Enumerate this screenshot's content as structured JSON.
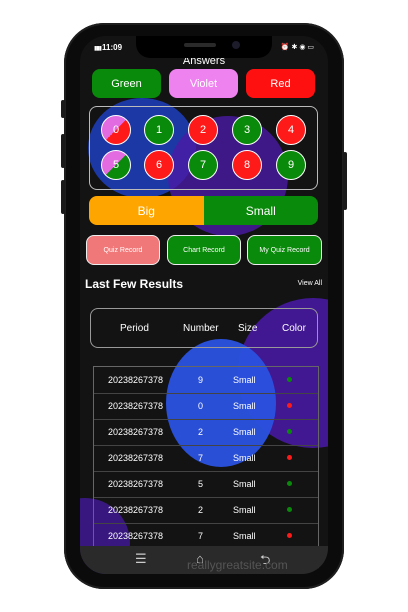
{
  "status_bar": {
    "time": "11:09",
    "signal": "▮▮▮",
    "indicators": "⏰ ✱ ◉ ▭"
  },
  "answers": {
    "title": "Answers",
    "color_buttons": [
      {
        "label": "Green",
        "color": "#0a8a0a"
      },
      {
        "label": "Violet",
        "color": "#ee82ee"
      },
      {
        "label": "Red",
        "color": "#ff1010"
      }
    ],
    "numbers": [
      {
        "label": "0",
        "colors": [
          "#ff1a1a",
          "#e26be2"
        ]
      },
      {
        "label": "1",
        "colors": [
          "#0a8a0a"
        ]
      },
      {
        "label": "2",
        "colors": [
          "#ff1a1a"
        ]
      },
      {
        "label": "3",
        "colors": [
          "#0a8a0a"
        ]
      },
      {
        "label": "4",
        "colors": [
          "#ff1a1a"
        ]
      },
      {
        "label": "5",
        "colors": [
          "#0a8a0a",
          "#e26be2"
        ]
      },
      {
        "label": "6",
        "colors": [
          "#ff1a1a"
        ]
      },
      {
        "label": "7",
        "colors": [
          "#0a8a0a"
        ]
      },
      {
        "label": "8",
        "colors": [
          "#ff1a1a"
        ]
      },
      {
        "label": "9",
        "colors": [
          "#0a8a0a"
        ]
      }
    ],
    "big_label": "Big",
    "small_label": "Small",
    "big_color": "#ffa500",
    "small_color": "#0a8a0a"
  },
  "actions": {
    "quiz_record": "Quiz Record",
    "chart_record": "Chart Record",
    "my_quiz_record": "My Quiz Record",
    "quiz_record_color": "#f07878",
    "green": "#0a8a0a"
  },
  "results": {
    "title": "Last Few Results",
    "view_all": "View All",
    "columns": {
      "period": "Period",
      "number": "Number",
      "size": "Size",
      "color": "Color"
    },
    "rows": [
      {
        "period": "20238267378",
        "number": "9",
        "size": "Small",
        "color": "#0a8a0a"
      },
      {
        "period": "20238267378",
        "number": "0",
        "size": "Small",
        "color": "#ff1a1a"
      },
      {
        "period": "20238267378",
        "number": "2",
        "size": "Small",
        "color": "#0a8a0a"
      },
      {
        "period": "20238267378",
        "number": "7",
        "size": "Small",
        "color": "#ff1a1a"
      },
      {
        "period": "20238267378",
        "number": "5",
        "size": "Small",
        "color": "#0a8a0a"
      },
      {
        "period": "20238267378",
        "number": "2",
        "size": "Small",
        "color": "#0a8a0a"
      },
      {
        "period": "20238267378",
        "number": "7",
        "size": "Small",
        "color": "#ff1a1a"
      }
    ]
  },
  "navbar": {
    "menu_icon": "☰",
    "home_icon": "⌂",
    "back_icon": "⮌"
  },
  "watermark": "reallygreatsite.com"
}
